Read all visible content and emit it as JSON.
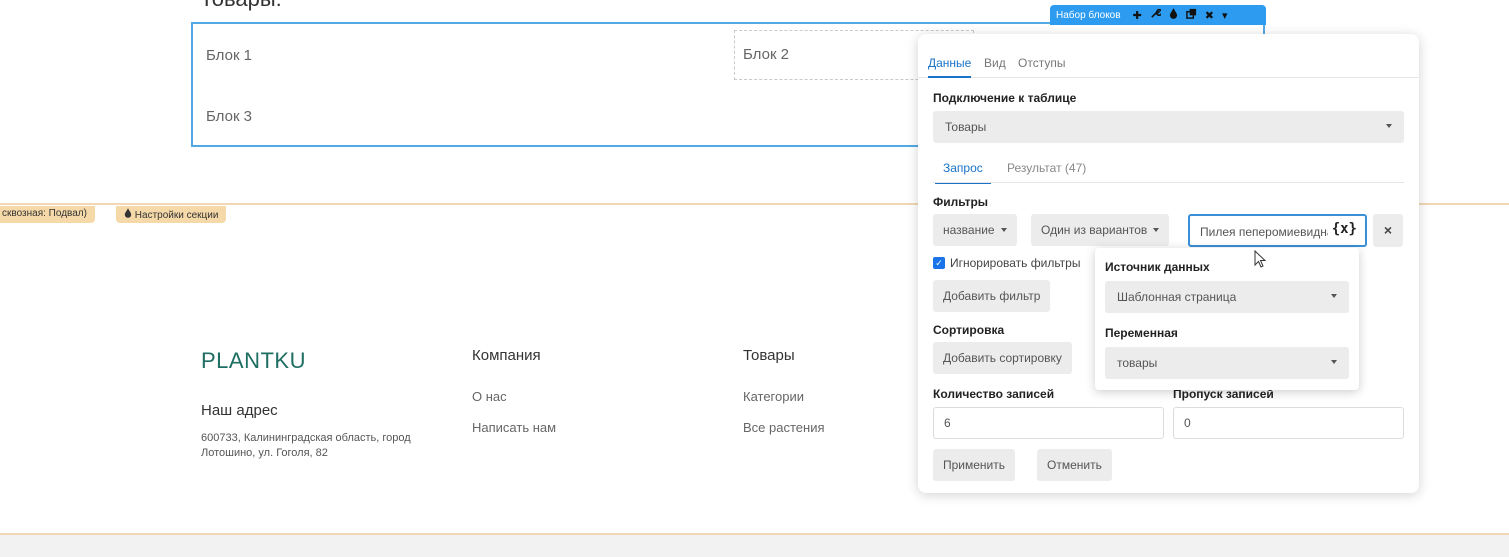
{
  "editor": {
    "heading": "Товары:",
    "blocks": [
      "Блок 1",
      "Блок 2",
      "Блок 3"
    ],
    "toolbar": {
      "title": "Набор блоков",
      "icons": [
        "plus-icon",
        "wrench-icon",
        "drop-icon",
        "copy-icon",
        "close-icon",
        "chevron-down-icon"
      ]
    }
  },
  "section": {
    "tag_left": "сквозная: Подвал)",
    "tag_settings": "Настройки секции"
  },
  "footer": {
    "brand": "PLANTKU",
    "address_title": "Наш адрес",
    "address_text": "600733, Калининградская область, город Лотошино, ул. Гоголя, 82",
    "columns": [
      {
        "title": "Компания",
        "links": [
          "О нас",
          "Написать нам"
        ]
      },
      {
        "title": "Товары",
        "links": [
          "Категории",
          "Все растения"
        ]
      }
    ]
  },
  "panel": {
    "tabs": [
      "Данные",
      "Вид",
      "Отступы"
    ],
    "active_tab": "Данные",
    "table_label": "Подключение к таблице",
    "table_value": "Товары",
    "subtabs": [
      "Запрос",
      "Результат (47)"
    ],
    "filters_label": "Фильтры",
    "filter": {
      "field": "название",
      "operator": "Один из вариантов",
      "value": "Пилея пеперомиевидная",
      "var_symbol": "{x}",
      "remove": "×"
    },
    "ignore_filters_label": "Игнорировать фильтры",
    "add_filter": "Добавить фильтр",
    "sort_label": "Сортировка",
    "add_sort": "Добавить сортировку",
    "count_label": "Количество записей",
    "count_value": "6",
    "skip_label": "Пропуск записей",
    "skip_value": "0",
    "apply": "Применить",
    "cancel": "Отменить"
  },
  "popover": {
    "source_label": "Источник данных",
    "source_value": "Шаблонная страница",
    "variable_label": "Переменная",
    "variable_value": "товары"
  },
  "colors": {
    "accent": "#1a73c8",
    "selection": "#52a9e3",
    "brand": "#1e6e62",
    "section_tag": "#f5d9a8"
  }
}
